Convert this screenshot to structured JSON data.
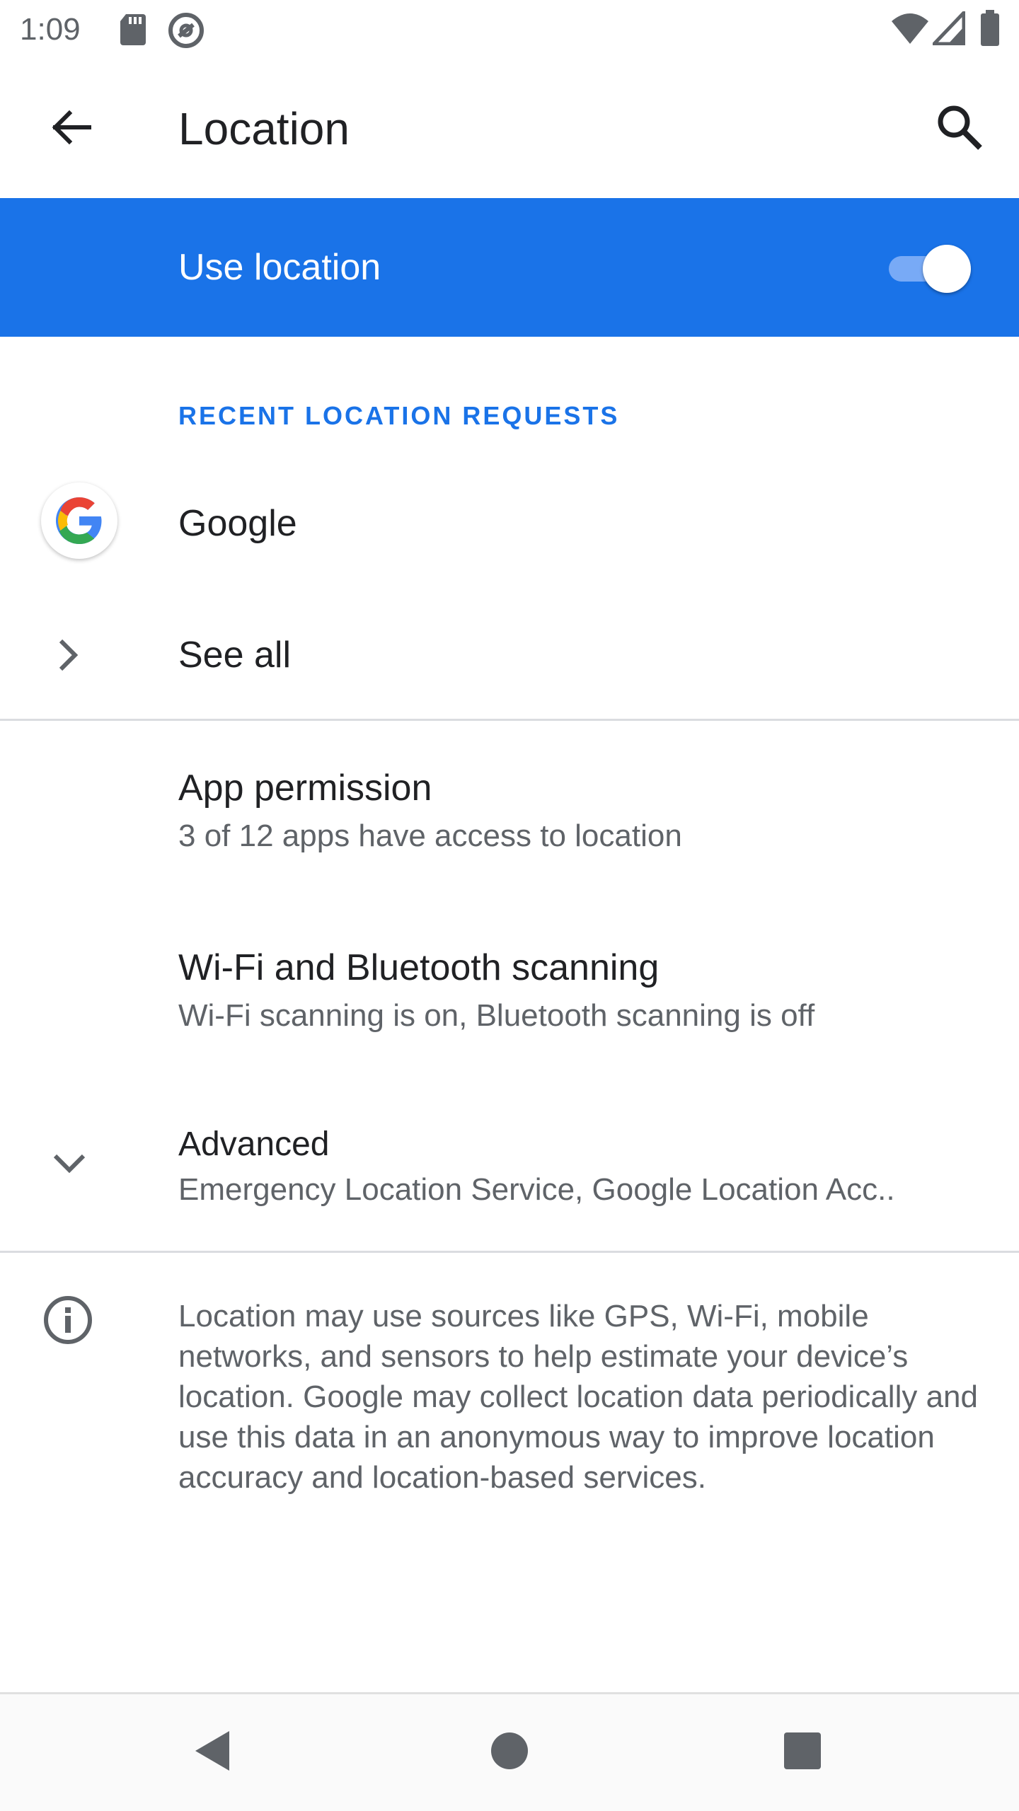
{
  "status_bar": {
    "time": "1:09",
    "left_icons": [
      "sd-card-icon",
      "data-saver-icon"
    ],
    "right_icons": [
      "wifi-icon",
      "cell-signal-icon",
      "battery-icon"
    ]
  },
  "app_bar": {
    "title": "Location",
    "back_icon": "arrow-back-icon",
    "search_icon": "search-icon"
  },
  "master_switch": {
    "label": "Use location",
    "checked": true,
    "background_color": "#1a73e8"
  },
  "recent_requests": {
    "header": "RECENT LOCATION REQUESTS",
    "apps": [
      {
        "name": "Google",
        "icon": "google-g-icon"
      }
    ],
    "see_all": "See all"
  },
  "settings": [
    {
      "title": "App permission",
      "summary": "3 of 12 apps have access to location"
    },
    {
      "title": "Wi-Fi and Bluetooth scanning",
      "summary": "Wi-Fi scanning is on, Bluetooth scanning is off"
    },
    {
      "title": "Advanced",
      "summary": "Emergency Location Service, Google Location Acc..",
      "icon": "chevron-down-icon"
    }
  ],
  "footer": {
    "icon": "info-icon",
    "text": "Location may use sources like GPS, Wi-Fi, mobile networks, and sensors to help estimate your device’s location. Google may collect location data periodically and use this data in an anonymous way to improve location accuracy and location-based services."
  },
  "nav_bar": {
    "buttons": [
      "nav-back-icon",
      "nav-home-icon",
      "nav-recents-icon"
    ]
  },
  "colors": {
    "accent": "#1a73e8",
    "primary_text": "#202124",
    "secondary_text": "#5f6368"
  }
}
